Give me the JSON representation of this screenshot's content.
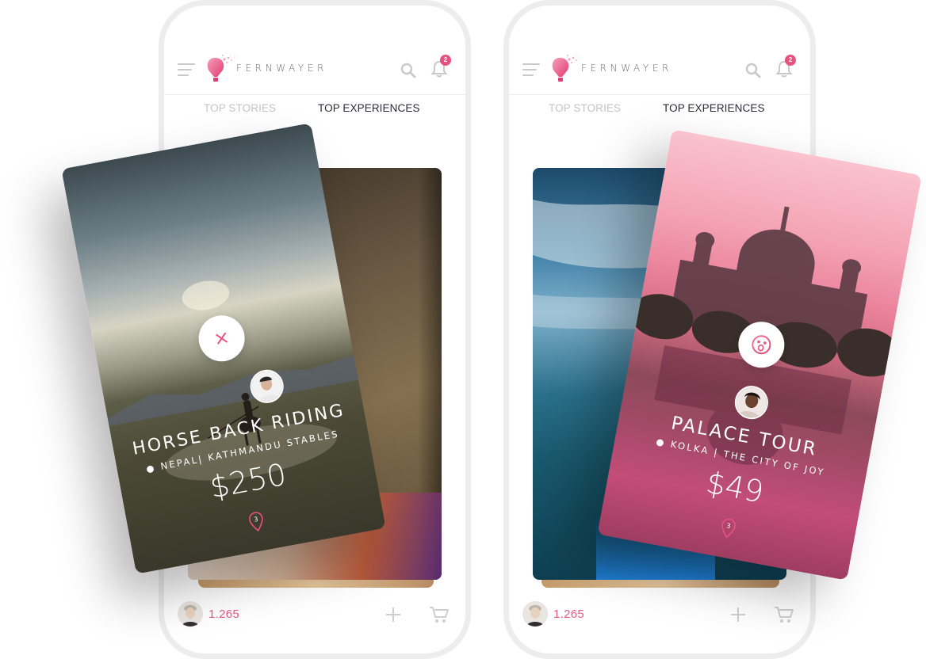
{
  "app": {
    "brand": "FERNWAYER",
    "notification_count": "2",
    "tabs": {
      "top_stories": "TOP STORIES",
      "top_experiences": "TOP EXPERIENCES"
    },
    "footer_count": "1.265"
  },
  "screens": [
    {
      "card": {
        "title": "HORSE BACK RIDING",
        "location": "NEPAL| KATHMANDU STABLES",
        "price": "$250",
        "pin_number": "3",
        "action_icon": "close-icon"
      }
    },
    {
      "card": {
        "title": "PALACE TOUR",
        "location": "KOLKA | THE CITY OF JOY",
        "price": "$49",
        "pin_number": "3",
        "action_icon": "wow-emoji-icon"
      }
    }
  ],
  "colors": {
    "accent": "#e8527f",
    "brand_text": "#6a6a7a",
    "tab_active": "#2b2b3a",
    "tab_inactive": "#c3c3cc"
  }
}
